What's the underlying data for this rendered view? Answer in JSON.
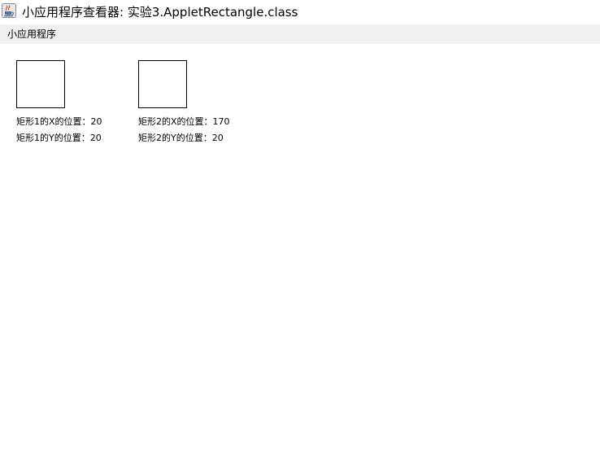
{
  "window": {
    "title": "小应用程序查看器: 实验3.AppletRectangle.class",
    "icon": "java-coffee-cup-icon"
  },
  "menubar": {
    "applet_menu_label": "小应用程序"
  },
  "applet": {
    "rectangles": [
      {
        "x_label": "矩形1的X的位置：20",
        "y_label": "矩形1的Y的位置：20"
      },
      {
        "x_label": "矩形2的X的位置：170",
        "y_label": "矩形2的Y的位置：20"
      }
    ]
  }
}
